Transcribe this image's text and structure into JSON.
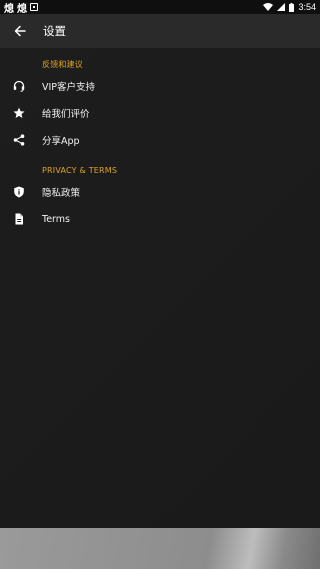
{
  "statusbar": {
    "notification_1": "熄",
    "notification_2": "熄",
    "time": "3:54"
  },
  "appbar": {
    "title": "设置"
  },
  "sections": [
    {
      "header": "反馈和建议",
      "items": [
        {
          "label": "VIP客户支持",
          "icon": "headset-icon"
        },
        {
          "label": "给我们评价",
          "icon": "star-icon"
        },
        {
          "label": "分享App",
          "icon": "share-icon"
        }
      ]
    },
    {
      "header": "PRIVACY & TERMS",
      "items": [
        {
          "label": "隐私政策",
          "icon": "shield-icon"
        },
        {
          "label": "Terms",
          "icon": "document-icon"
        }
      ]
    }
  ],
  "colors": {
    "accent": "#e0a320",
    "appbar": "#2a2a2a",
    "background": "#1c1c1c"
  }
}
